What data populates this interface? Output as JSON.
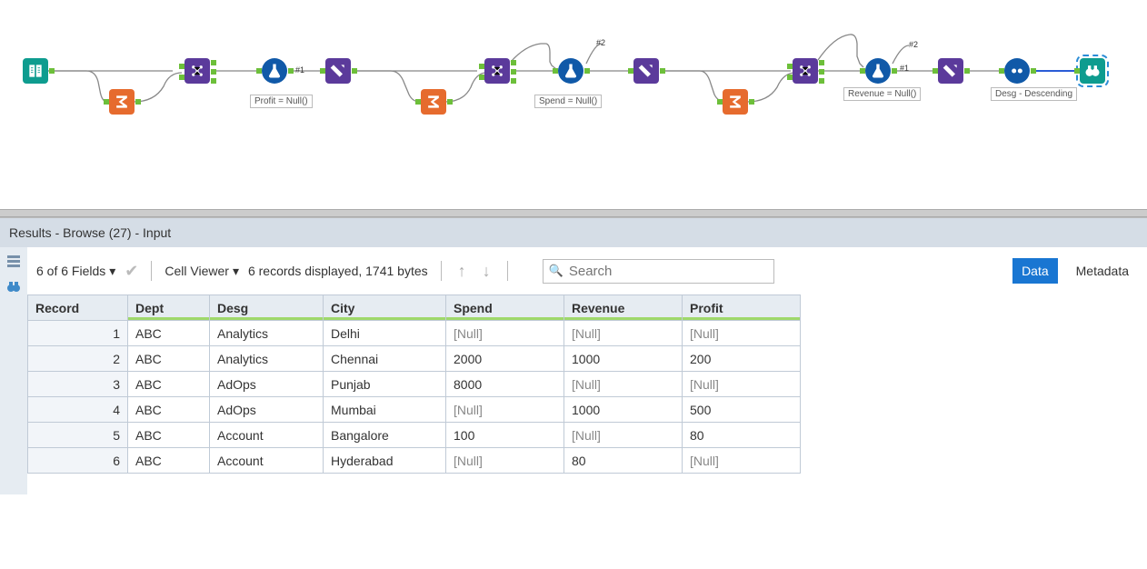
{
  "workflow": {
    "labels": {
      "profit": "Profit = Null()",
      "spend": "Spend = Null()",
      "revenue": "Revenue = Null()",
      "sort": "Desg - Descending",
      "hash1": "#1",
      "hash2": "#2"
    }
  },
  "results": {
    "title": "Results - Browse (27) - Input",
    "fields_dropdown": "6 of 6 Fields",
    "cell_viewer": "Cell Viewer",
    "records_info": "6 records displayed, 1741 bytes",
    "search_placeholder": "Search",
    "tab_data": "Data",
    "tab_metadata": "Metadata"
  },
  "grid": {
    "columns": [
      "Record",
      "Dept",
      "Desg",
      "City",
      "Spend",
      "Revenue",
      "Profit"
    ],
    "rows": [
      {
        "n": "1",
        "dept": "ABC",
        "desg": "Analytics",
        "city": "Delhi",
        "spend": null,
        "revenue": null,
        "profit": null
      },
      {
        "n": "2",
        "dept": "ABC",
        "desg": "Analytics",
        "city": "Chennai",
        "spend": "2000",
        "revenue": "1000",
        "profit": "200"
      },
      {
        "n": "3",
        "dept": "ABC",
        "desg": "AdOps",
        "city": "Punjab",
        "spend": "8000",
        "revenue": null,
        "profit": null
      },
      {
        "n": "4",
        "dept": "ABC",
        "desg": "AdOps",
        "city": "Mumbai",
        "spend": null,
        "revenue": "1000",
        "profit": "500"
      },
      {
        "n": "5",
        "dept": "ABC",
        "desg": "Account",
        "city": "Bangalore",
        "spend": "100",
        "revenue": null,
        "profit": "80"
      },
      {
        "n": "6",
        "dept": "ABC",
        "desg": "Account",
        "city": "Hyderabad",
        "spend": null,
        "revenue": "80",
        "profit": null
      }
    ],
    "null_text": "[Null]"
  }
}
